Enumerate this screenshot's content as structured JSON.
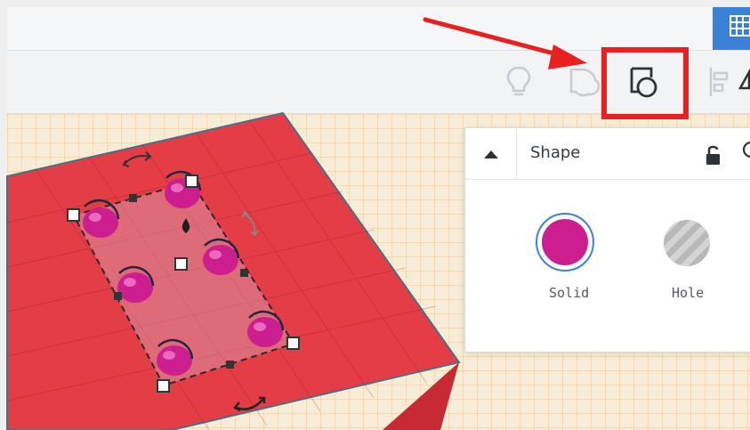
{
  "toolbar": {
    "tools": [
      {
        "name": "notes-tool",
        "icon": "lightbulb-icon"
      },
      {
        "name": "hide-tool",
        "icon": "cloud-shape-icon"
      },
      {
        "name": "group-tool",
        "icon": "group-shapes-icon",
        "highlighted": true
      },
      {
        "name": "align-tool",
        "icon": "align-icon"
      },
      {
        "name": "mirror-tool",
        "icon": "mirror-icon"
      }
    ]
  },
  "shape_panel": {
    "title": "Shape",
    "solid_label": "Solid",
    "hole_label": "Hole",
    "solid_color": "#cc1e8e"
  },
  "scene": {
    "box_color": "#e43d46",
    "sphere_color": "#cc1e8e",
    "sphere_count": 6
  },
  "annotation": {
    "arrow_color": "#e8201f",
    "highlight_box_color": "#e8201f"
  }
}
